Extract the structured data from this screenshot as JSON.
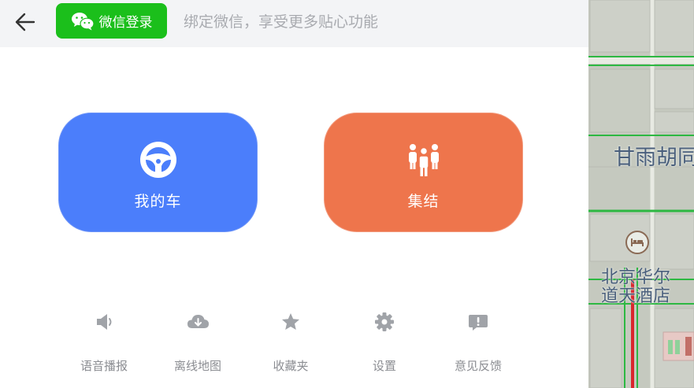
{
  "header": {
    "wechat_login_label": "微信登录",
    "hint_text": "绑定微信，享受更多贴心功能"
  },
  "cards": {
    "my_car_label": "我的车",
    "gather_label": "集结"
  },
  "tools": [
    {
      "label": "语音播报",
      "icon": "speaker-icon"
    },
    {
      "label": "离线地图",
      "icon": "cloud-download-icon"
    },
    {
      "label": "收藏夹",
      "icon": "star-icon"
    },
    {
      "label": "设置",
      "icon": "gear-icon"
    },
    {
      "label": "意见反馈",
      "icon": "feedback-icon"
    }
  ],
  "map": {
    "street_label": "甘雨胡同",
    "poi_label_line1": "北京华尔",
    "poi_label_line2": "道天酒店",
    "poi_icon": "hotel-icon"
  },
  "colors": {
    "wechat_green": "#1bbf1b",
    "my_car_blue": "#4b7efb",
    "gather_orange": "#ee754c",
    "tool_gray": "#8b8d92",
    "map_road_green": "#2db842",
    "map_route_red": "#d9262d"
  }
}
